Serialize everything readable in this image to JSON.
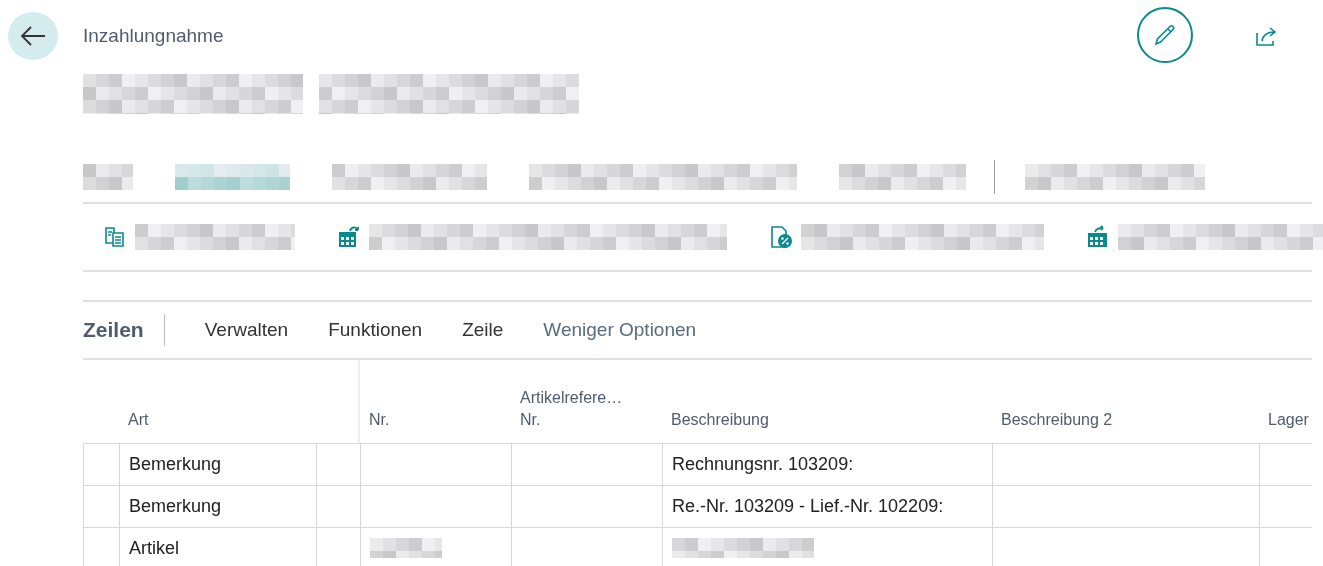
{
  "header": {
    "title": "Inzahlungnahme"
  },
  "tabs": [
    {
      "selected": false
    },
    {
      "selected": true
    },
    {
      "selected": false
    },
    {
      "selected": false
    },
    {
      "selected": false
    },
    {
      "selected": false
    }
  ],
  "actions": [
    {
      "kind": "copy"
    },
    {
      "kind": "calendar-undo"
    },
    {
      "kind": "percent-doc"
    },
    {
      "kind": "calendar-share"
    }
  ],
  "lines": {
    "title": "Zeilen",
    "menu": [
      {
        "label": "Verwalten",
        "kind": "menu"
      },
      {
        "label": "Funktionen",
        "kind": "menu"
      },
      {
        "label": "Zeile",
        "kind": "menu"
      },
      {
        "label": "Weniger Optionen",
        "kind": "link"
      }
    ],
    "columns": [
      {
        "label": "Art"
      },
      {
        "label": "Nr."
      },
      {
        "label": "Artikelrefere…\nNr."
      },
      {
        "label": "Beschreibung"
      },
      {
        "label": "Beschreibung 2"
      },
      {
        "label": "Lager"
      }
    ],
    "rows": [
      {
        "art": "Bemerkung",
        "beschreibung": "Rechnungsnr. 103209:",
        "redacted": false
      },
      {
        "art": "Bemerkung",
        "beschreibung": "Re.-Nr. 103209 - Lief.-Nr. 102209:",
        "redacted": false
      },
      {
        "art": "Artikel",
        "redacted": true
      }
    ]
  }
}
